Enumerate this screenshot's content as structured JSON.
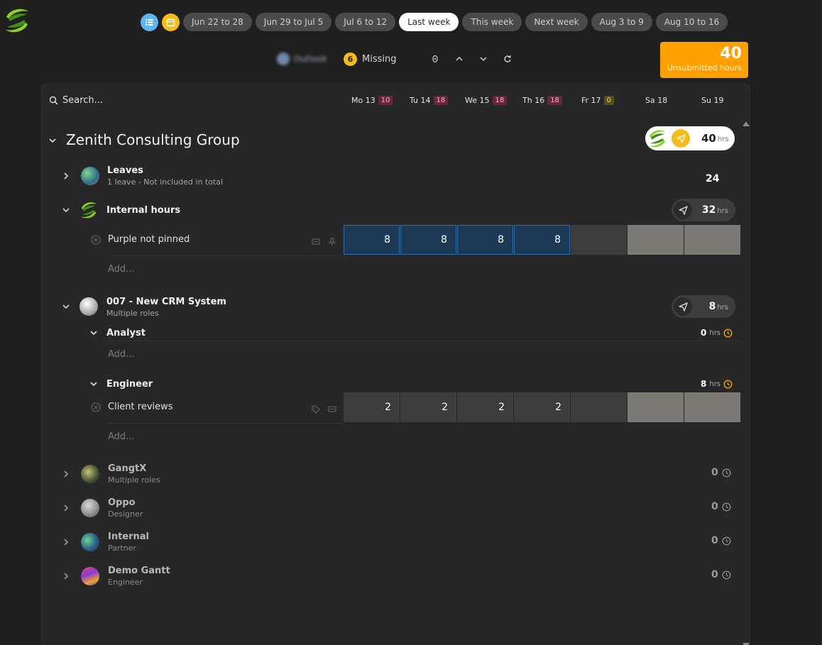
{
  "weeks": [
    {
      "label": "Jun 22 to 28",
      "active": false
    },
    {
      "label": "Jun 29 to Jul 5",
      "active": false
    },
    {
      "label": "Jul 6 to 12",
      "active": false
    },
    {
      "label": "Last week",
      "active": true
    },
    {
      "label": "This week",
      "active": false
    },
    {
      "label": "Next week",
      "active": false
    },
    {
      "label": "Aug 3 to 9",
      "active": false
    },
    {
      "label": "Aug 10 to 16",
      "active": false
    }
  ],
  "toolbar": {
    "outlook_label": "Outlook",
    "missing_count": "6",
    "missing_label": "Missing"
  },
  "unsubmitted": {
    "value": "40",
    "label": "Unsubmitted hours"
  },
  "search": {
    "placeholder": "Search..."
  },
  "days": [
    {
      "label": "Mo 13",
      "badge": "10",
      "color": "red"
    },
    {
      "label": "Tu 14",
      "badge": "18",
      "color": "red"
    },
    {
      "label": "We 15",
      "badge": "18",
      "color": "red"
    },
    {
      "label": "Th 16",
      "badge": "18",
      "color": "red"
    },
    {
      "label": "Fr 17",
      "badge": "0",
      "color": "brown"
    },
    {
      "label": "Sa 18",
      "badge": "",
      "color": ""
    },
    {
      "label": "Su 19",
      "badge": "",
      "color": ""
    }
  ],
  "client": {
    "name": "Zenith Consulting Group",
    "total": "40",
    "unit": "hrs"
  },
  "leaves": {
    "title": "Leaves",
    "subtitle": "1 leave - Not included in total",
    "total": "24"
  },
  "internal_hours": {
    "title": "Internal hours",
    "total": "32",
    "unit": "hrs",
    "task": "Purple not pinned",
    "cells": [
      "8",
      "8",
      "8",
      "8",
      "",
      "",
      ""
    ],
    "add_label": "Add..."
  },
  "crm": {
    "title": "007 - New CRM System",
    "subtitle": "Multiple roles",
    "total": "8",
    "unit": "hrs",
    "roles": [
      {
        "name": "Analyst",
        "hours": "0",
        "unit": "hrs",
        "add_label": "Add..."
      },
      {
        "name": "Engineer",
        "hours": "8",
        "unit": "hrs",
        "task": "Client reviews",
        "cells": [
          "2",
          "2",
          "2",
          "2",
          "",
          "",
          ""
        ],
        "add_label": "Add..."
      }
    ]
  },
  "projects": [
    {
      "title": "GangtX",
      "subtitle": "Multiple roles",
      "total": "0"
    },
    {
      "title": "Oppo",
      "subtitle": "Designer",
      "total": "0"
    },
    {
      "title": "Internal",
      "subtitle": "Partner",
      "total": "0"
    },
    {
      "title": "Demo Gantt",
      "subtitle": "Engineer",
      "total": "0"
    }
  ],
  "colors": {
    "accent": "#ffa000",
    "badge_yellow": "#f2bc1c",
    "cell_blue": "#1c3956",
    "cell_weekend": "#7c7873"
  }
}
